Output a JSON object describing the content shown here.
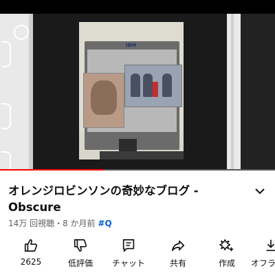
{
  "video": {
    "progress_fraction": 0.38,
    "brand_text": "IBM",
    "progress_color": "#ff0000"
  },
  "title": "オレンジロビンソンの奇妙なブログ - Obscure",
  "meta": {
    "views": "14万 回視聴",
    "separator": "・",
    "age": "8 か月前",
    "hashtag": "#Q"
  },
  "actions": [
    {
      "icon": "thumbs-up-icon",
      "label": "2625"
    },
    {
      "icon": "thumbs-down-icon",
      "label": "低評価"
    },
    {
      "icon": "chat-icon",
      "label": "チャット"
    },
    {
      "icon": "share-icon",
      "label": "共有"
    },
    {
      "icon": "create-icon",
      "label": "作成"
    },
    {
      "icon": "offline-icon",
      "label": "オフラ"
    }
  ],
  "colors": {
    "link": "#065fd4",
    "text": "#0f0f0f",
    "secondary": "#606060"
  }
}
